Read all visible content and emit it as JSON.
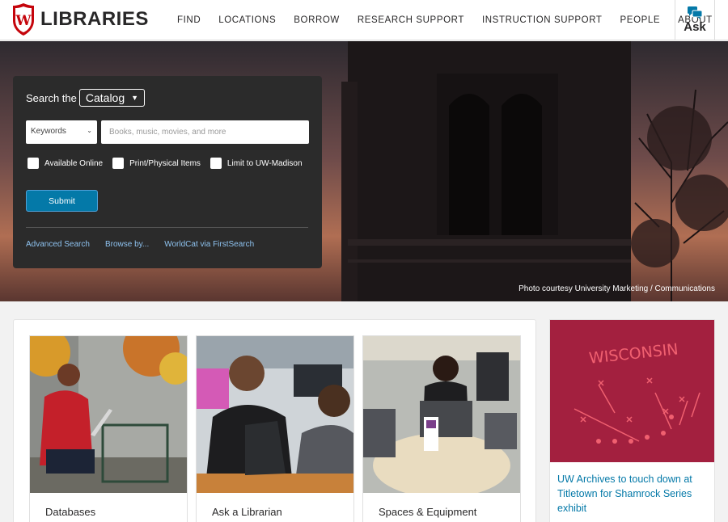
{
  "header": {
    "logo_text": "LIBRARIES",
    "crest_letter": "W",
    "nav": [
      "FIND",
      "LOCATIONS",
      "BORROW",
      "RESEARCH SUPPORT",
      "INSTRUCTION SUPPORT",
      "PEOPLE",
      "ABOUT"
    ],
    "ask_label": "Ask"
  },
  "hero": {
    "credit": "Photo courtesy University Marketing / Communications"
  },
  "search": {
    "label": "Search the",
    "scope": "Catalog",
    "field": "Keywords",
    "placeholder": "Books, music, movies, and more",
    "value": "",
    "filters": [
      "Available Online",
      "Print/Physical Items",
      "Limit to UW-Madison"
    ],
    "submit": "Submit",
    "links": [
      "Advanced Search",
      "Browse by...",
      "WorldCat via FirstSearch"
    ]
  },
  "cards": [
    {
      "title": "Databases"
    },
    {
      "title": "Ask a Librarian"
    },
    {
      "title": "Spaces & Equipment"
    }
  ],
  "news": {
    "image_text": "WISCONSIN",
    "title": "UW Archives to touch down at Titletown for Shamrock Series exhibit"
  },
  "colors": {
    "brand_red": "#c5050c",
    "link_blue": "#0479a8",
    "panel_dark": "#2b2b2b",
    "news_red": "#a3203f"
  }
}
